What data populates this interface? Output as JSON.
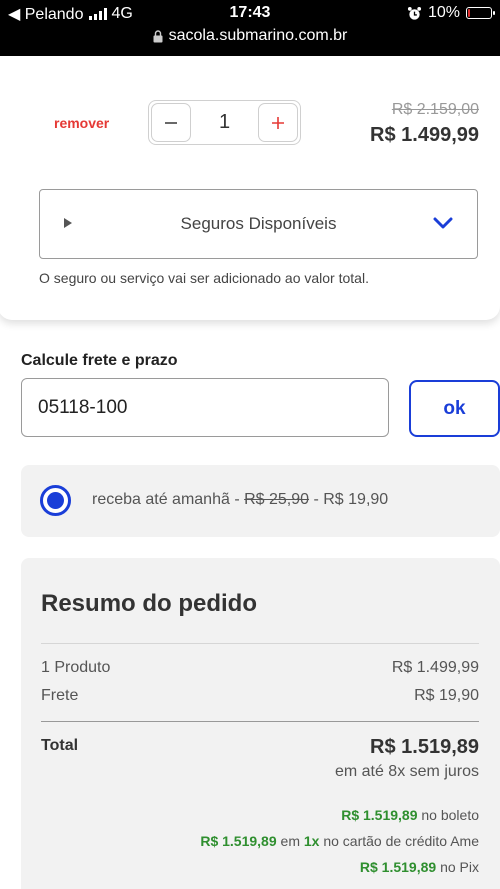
{
  "status_bar": {
    "carrier": "◀ Pelando",
    "network": "4G",
    "time": "17:43",
    "battery": "10%",
    "battery_level": 0.1,
    "url": "sacola.submarino.com.br"
  },
  "product": {
    "remove_label": "remover",
    "quantity": "1",
    "old_price": "R$ 2.159,00",
    "price": "R$ 1.499,99",
    "insurance_label": "Seguros Disponíveis",
    "insurance_note": "O seguro ou serviço vai ser adicionado ao valor total."
  },
  "shipping": {
    "title": "Calcule frete e prazo",
    "cep_value": "05118-100",
    "ok_label": "ok",
    "option_prefix": "receba até amanhã - ",
    "option_old": "R$ 25,90",
    "option_new": " - R$ 19,90"
  },
  "summary": {
    "title": "Resumo do pedido",
    "products_label": "1 Produto",
    "products_value": "R$ 1.499,99",
    "freight_label": "Frete",
    "freight_value": "R$ 19,90",
    "total_label": "Total",
    "total_value": "R$ 1.519,89",
    "installments": "em até 8x sem juros",
    "boleto_value": "R$ 1.519,89",
    "boleto_label": " no boleto",
    "card_value": "R$ 1.519,89",
    "card_mid": " em ",
    "card_times": "1x",
    "card_label": " no cartão de crédito Ame",
    "pix_value": "R$ 1.519,89",
    "pix_label": " no Pix"
  },
  "colors": {
    "accent": "#1a3ed8",
    "remove": "#e53935",
    "green": "#2f8f2f"
  }
}
